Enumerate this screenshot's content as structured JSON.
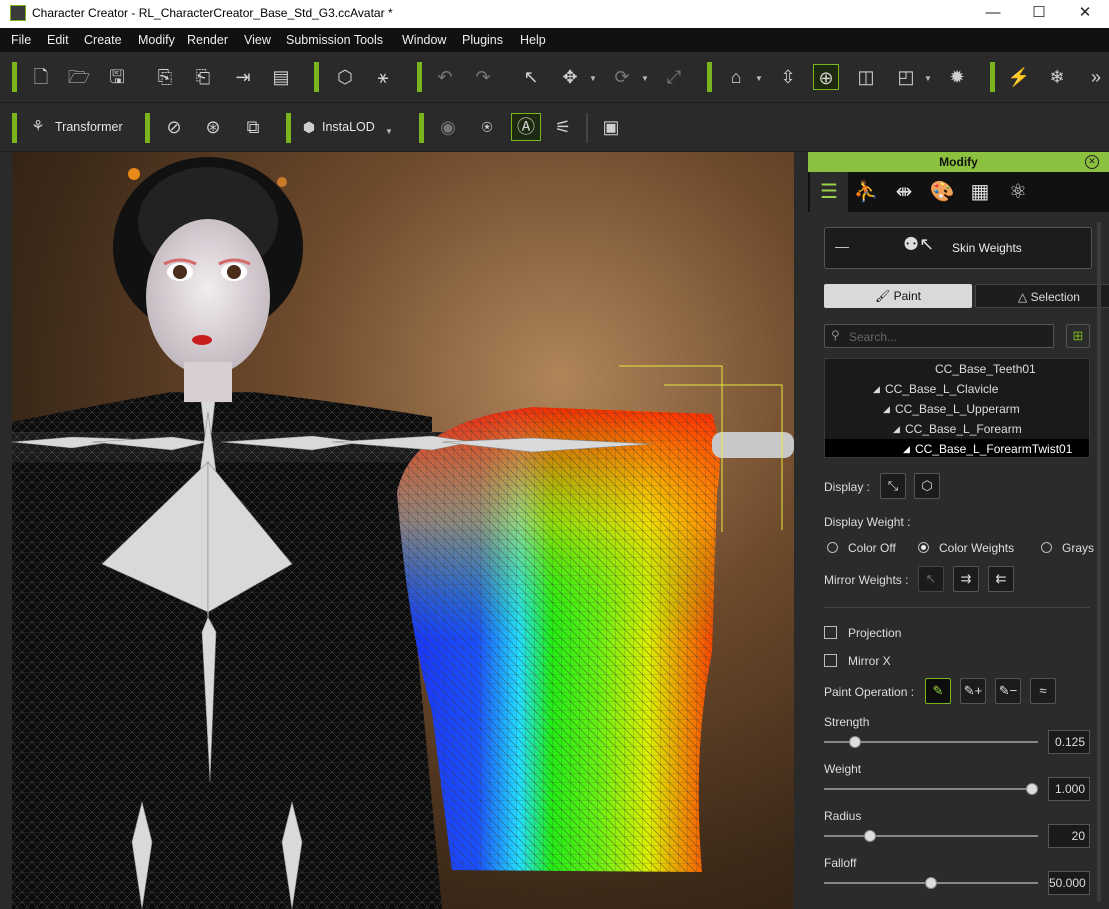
{
  "window": {
    "title": "Character Creator - RL_CharacterCreator_Base_Std_G3.ccAvatar *",
    "minimize": "—",
    "maximize": "☐",
    "close": "✕"
  },
  "menu": [
    "File",
    "Edit",
    "Create",
    "Modify",
    "Render",
    "View",
    "Submission Tools",
    "Window",
    "Plugins",
    "Help"
  ],
  "toolbar2": {
    "transformer_label": "Transformer",
    "instalod_label": "InstaLOD"
  },
  "panel": {
    "title": "Modify",
    "section": "Skin Weights",
    "mode_paint": "Paint",
    "mode_selection": "Selection",
    "search_placeholder": "Search...",
    "tree": [
      {
        "label": "CC_Base_Teeth01"
      },
      {
        "label": "CC_Base_L_Clavicle"
      },
      {
        "label": "CC_Base_L_Upperarm"
      },
      {
        "label": "CC_Base_L_Forearm"
      },
      {
        "label": "CC_Base_L_ForearmTwist01"
      }
    ],
    "display_label": "Display :",
    "display_weight_label": "Display Weight :",
    "display_weight_options": [
      "Color Off",
      "Color Weights",
      "Grays"
    ],
    "display_weight_selected": "Color Weights",
    "mirror_weights_label": "Mirror Weights :",
    "projection_label": "Projection",
    "mirror_x_label": "Mirror X",
    "paint_operation_label": "Paint Operation :",
    "sliders": {
      "strength": {
        "label": "Strength",
        "value": "0.125",
        "level": 0.125
      },
      "weight": {
        "label": "Weight",
        "value": "1.000",
        "level": 1.0
      },
      "radius": {
        "label": "Radius",
        "value": "20",
        "level": 0.2
      },
      "falloff": {
        "label": "Falloff",
        "value": "50.000",
        "level": 0.5
      }
    }
  },
  "colors": {
    "accent": "#8cc13f",
    "weight_blue": "#1030ff",
    "weight_green": "#22ee11",
    "weight_yellow": "#ffee00",
    "weight_red": "#ff2200"
  }
}
